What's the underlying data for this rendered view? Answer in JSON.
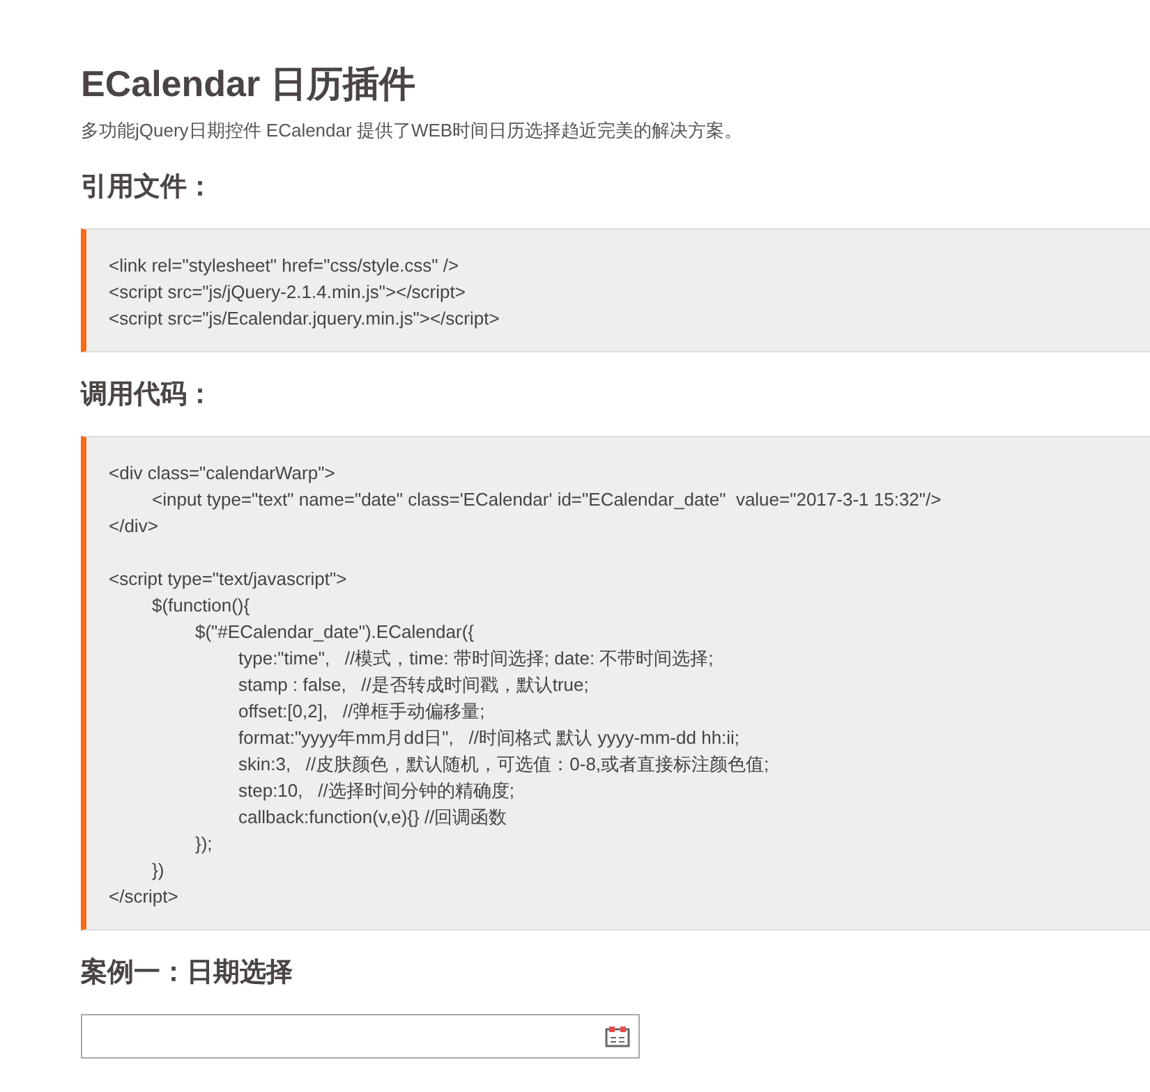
{
  "title": "ECalendar 日历插件",
  "intro": "多功能jQuery日期控件 ECalendar 提供了WEB时间日历选择趋近完美的解决方案。",
  "sections": [
    {
      "heading": "引用文件：",
      "code": [
        [
          {
            "text": "<link rel=\"stylesheet\" href=\"css/style.css\" />"
          },
          {
            "text": "<script src=\"js/jQuery-2.1.4.min.js\"></script>"
          },
          {
            "text": "<script src=\"js/Ecalendar.jquery.min.js\"></script>"
          }
        ]
      ]
    },
    {
      "heading": "调用代码：",
      "code": [
        [
          {
            "text": "<div class=\"calendarWarp\">",
            "children": [
              {
                "text": "<input type=\"text\" name=\"date\" class='ECalendar' id=\"ECalendar_date\"  value=\"2017-3-1 15:32\"/>"
              }
            ]
          },
          {
            "text": "</div>"
          }
        ],
        [
          {
            "text": "<script type=\"text/javascript\">",
            "children": [
              {
                "text": "$(function(){",
                "children": [
                  {
                    "text": "$(\"#ECalendar_date\").ECalendar({",
                    "children": [
                      {
                        "text": "type:\"time\",   //模式，time: 带时间选择; date: 不带时间选择;"
                      },
                      {
                        "text": "stamp : false,   //是否转成时间戳，默认true;"
                      },
                      {
                        "text": "offset:[0,2],   //弹框手动偏移量;"
                      },
                      {
                        "text": "format:\"yyyy年mm月dd日\",   //时间格式 默认 yyyy-mm-dd hh:ii;"
                      },
                      {
                        "text": "skin:3,   //皮肤颜色，默认随机，可选值：0-8,或者直接标注颜色值;"
                      },
                      {
                        "text": "step:10,   //选择时间分钟的精确度;"
                      },
                      {
                        "text": "callback:function(v,e){} //回调函数"
                      }
                    ]
                  },
                  {
                    "text": "});"
                  }
                ]
              },
              {
                "text": "})"
              }
            ]
          },
          {
            "text": "</script>"
          }
        ]
      ]
    },
    {
      "heading": "案例一：日期选择",
      "date_field": {
        "kind": "date"
      }
    }
  ]
}
